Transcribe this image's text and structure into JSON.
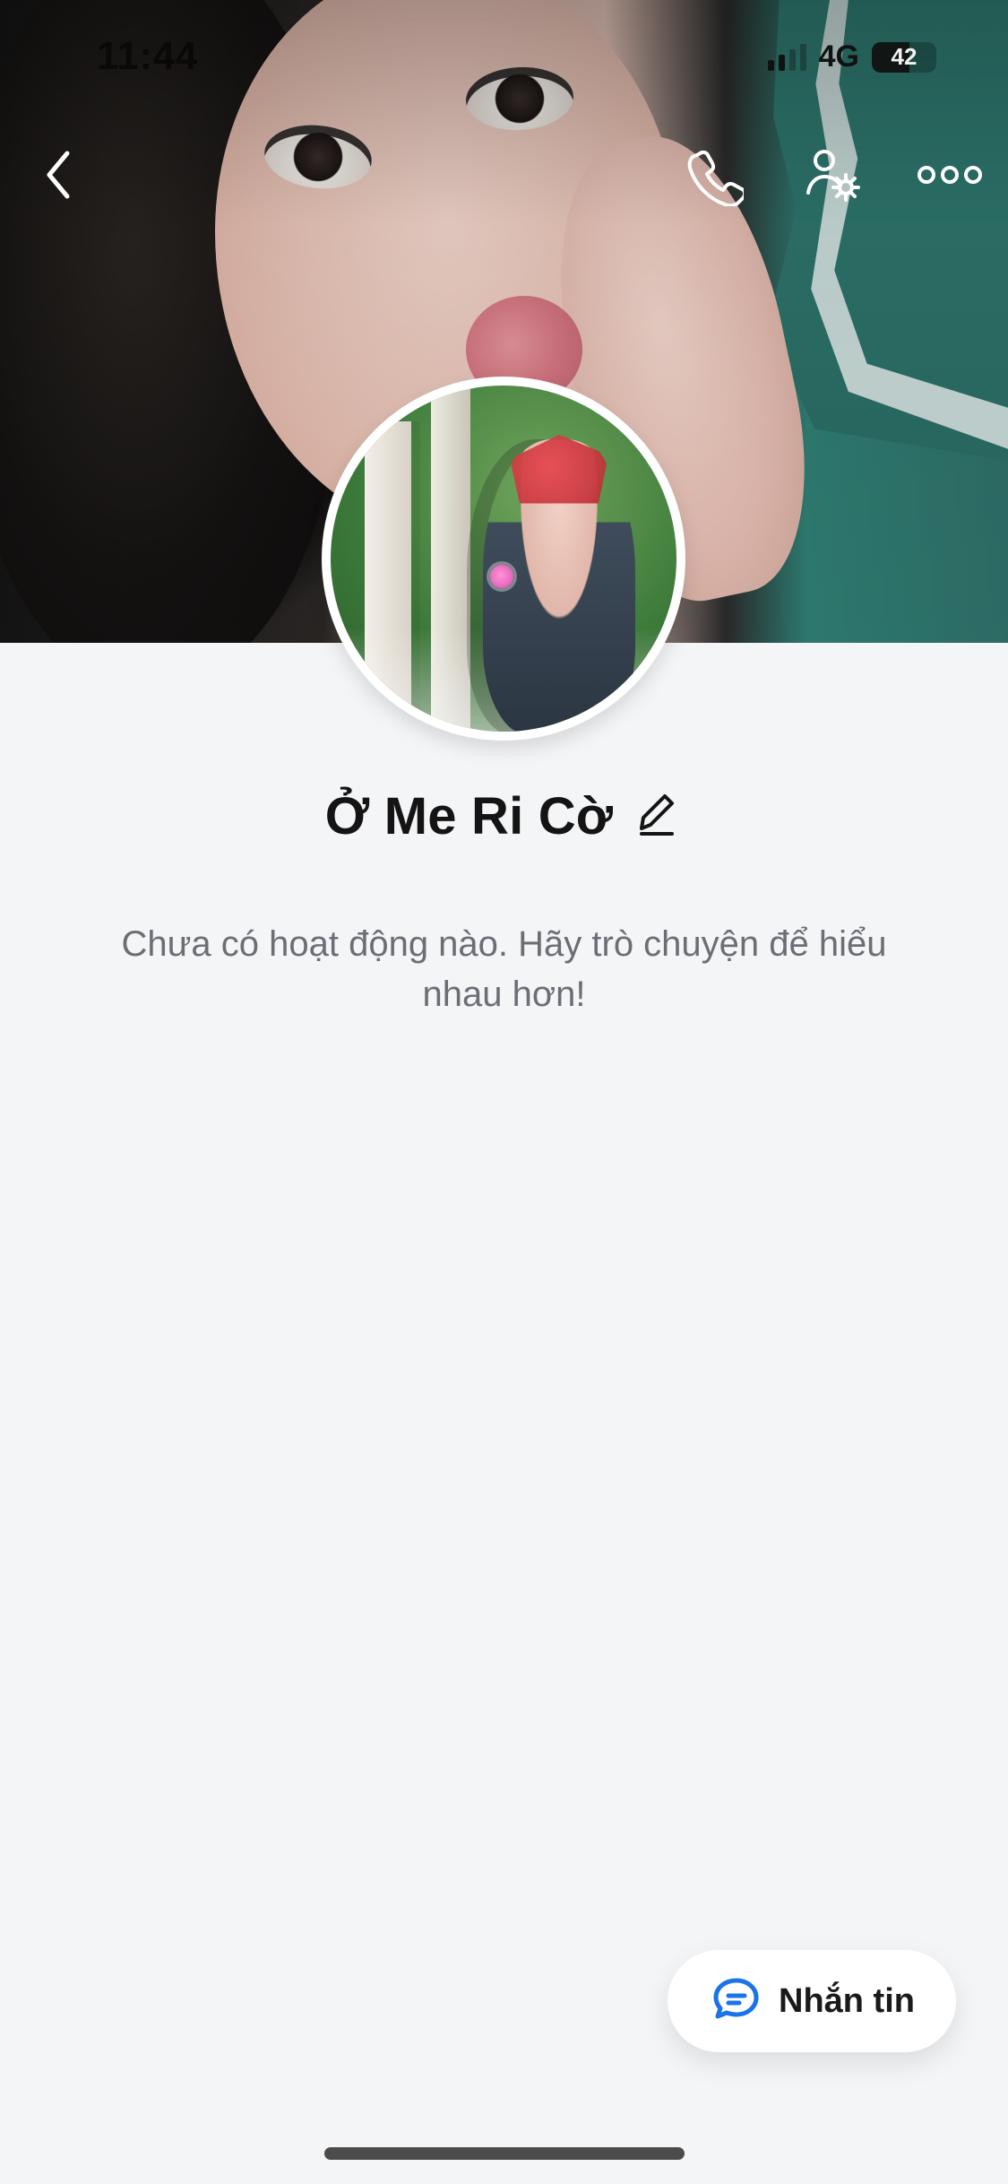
{
  "status_bar": {
    "time": "11:44",
    "network": "4G",
    "battery": "42"
  },
  "header": {
    "icons": {
      "back": "chevron-left-icon",
      "call": "phone-icon",
      "profile_settings": "user-gear-icon",
      "more": "more-horizontal-icon"
    }
  },
  "profile": {
    "name": "Ở Me Ri Cờ",
    "activity_empty": "Chưa có hoạt động nào. Hãy trò chuyện để hiểu nhau hơn!"
  },
  "actions": {
    "message_label": "Nhắn tin",
    "message_icon": "chat-bubble-icon"
  },
  "colors": {
    "page_bg": "#f4f5f7",
    "message_icon": "#1a73e8"
  }
}
